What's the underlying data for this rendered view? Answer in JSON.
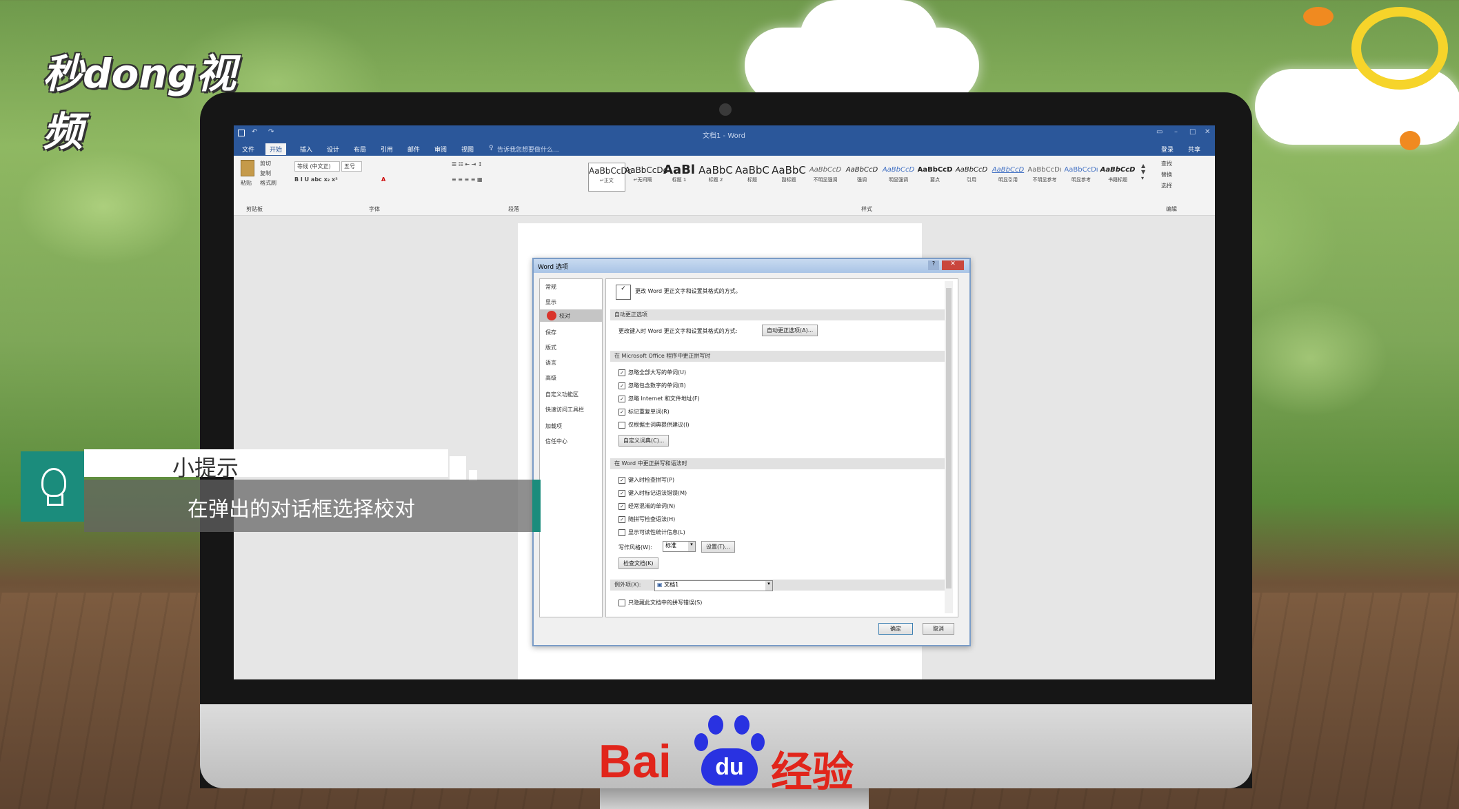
{
  "brand_logo": "秒dong视频",
  "word": {
    "window_title": "文档1 - Word",
    "tabs": [
      "文件",
      "开始",
      "插入",
      "设计",
      "布局",
      "引用",
      "邮件",
      "审阅",
      "视图"
    ],
    "active_tab": "开始",
    "tell_me": "告诉我您想要做什么...",
    "signin": "登录",
    "share": "共享",
    "clipboard": {
      "paste": "粘贴",
      "cut": "剪切",
      "copy": "复制",
      "format_painter": "格式刷",
      "group": "剪贴板"
    },
    "font": {
      "name": "等线 (中文正)",
      "size": "五号",
      "group": "字体"
    },
    "paragraph_group": "段落",
    "styles": [
      {
        "preview": "AaBbCcDc",
        "name": "↵正文"
      },
      {
        "preview": "AaBbCcDc",
        "name": "↵无间隔"
      },
      {
        "preview": "AaBl",
        "name": "标题 1"
      },
      {
        "preview": "AaBbC",
        "name": "标题 2"
      },
      {
        "preview": "AaBbC",
        "name": "标题"
      },
      {
        "preview": "AaBbC",
        "name": "副标题"
      },
      {
        "preview": "AaBbCcD",
        "name": "不明显强调"
      },
      {
        "preview": "AaBbCcD",
        "name": "强调"
      },
      {
        "preview": "AaBbCcD",
        "name": "明显强调"
      },
      {
        "preview": "AaBbCcD",
        "name": "要点"
      },
      {
        "preview": "AaBbCcD",
        "name": "引用"
      },
      {
        "preview": "AaBbCcD",
        "name": "明显引用"
      },
      {
        "preview": "AaBbCcDı",
        "name": "不明显参考"
      },
      {
        "preview": "AaBbCcDı",
        "name": "明显参考"
      },
      {
        "preview": "AaBbCcD",
        "name": "书籍标题"
      }
    ],
    "styles_group": "样式",
    "editing": {
      "find": "查找",
      "replace": "替换",
      "select": "选择",
      "group": "编辑"
    }
  },
  "dialog": {
    "title": "Word 选项",
    "nav": [
      "常规",
      "显示",
      "校对",
      "保存",
      "版式",
      "语言",
      "高级",
      "自定义功能区",
      "快速访问工具栏",
      "加载项",
      "信任中心"
    ],
    "selected_nav": "校对",
    "header": "更改 Word 更正文字和设置其格式的方式。",
    "sec_autocorrect": "自动更正选项",
    "autocorrect_text": "更改键入时 Word 更正文字和设置其格式的方式:",
    "autocorrect_button": "自动更正选项(A)...",
    "sec_office": "在 Microsoft Office 程序中更正拼写时",
    "office_opts": [
      {
        "label": "忽略全部大写的单词(U)",
        "checked": true
      },
      {
        "label": "忽略包含数字的单词(B)",
        "checked": true
      },
      {
        "label": "忽略 Internet 和文件地址(F)",
        "checked": true
      },
      {
        "label": "标记重复单词(R)",
        "checked": true
      },
      {
        "label": "仅根据主词典提供建议(I)",
        "checked": false
      }
    ],
    "custom_dict_button": "自定义词典(C)...",
    "sec_word": "在 Word 中更正拼写和语法时",
    "word_opts": [
      {
        "label": "键入时检查拼写(P)",
        "checked": true
      },
      {
        "label": "键入时标记语法错误(M)",
        "checked": true
      },
      {
        "label": "经常混淆的单词(N)",
        "checked": true
      },
      {
        "label": "随拼写检查语法(H)",
        "checked": true
      },
      {
        "label": "显示可读性统计信息(L)",
        "checked": false
      }
    ],
    "writing_style_label": "写作风格(W):",
    "writing_style_value": "标准",
    "settings_button": "设置(T)...",
    "check_doc_button": "检查文档(K)",
    "exceptions_label": "例外项(X):",
    "exceptions_value": "文档1",
    "hide_errors": "只隐藏此文档中的拼写错误(S)",
    "ok": "确定",
    "cancel": "取消"
  },
  "tip": {
    "title": "小提示",
    "text": "在弹出的对话框选择校对"
  },
  "baidu": {
    "bai": "Bai",
    "du": "du",
    "jingyan": "经验"
  },
  "colors": {
    "word_blue": "#2b579a",
    "teal": "#1b8c7c",
    "baidu_red": "#e1251b",
    "baidu_blue": "#2932e1"
  }
}
